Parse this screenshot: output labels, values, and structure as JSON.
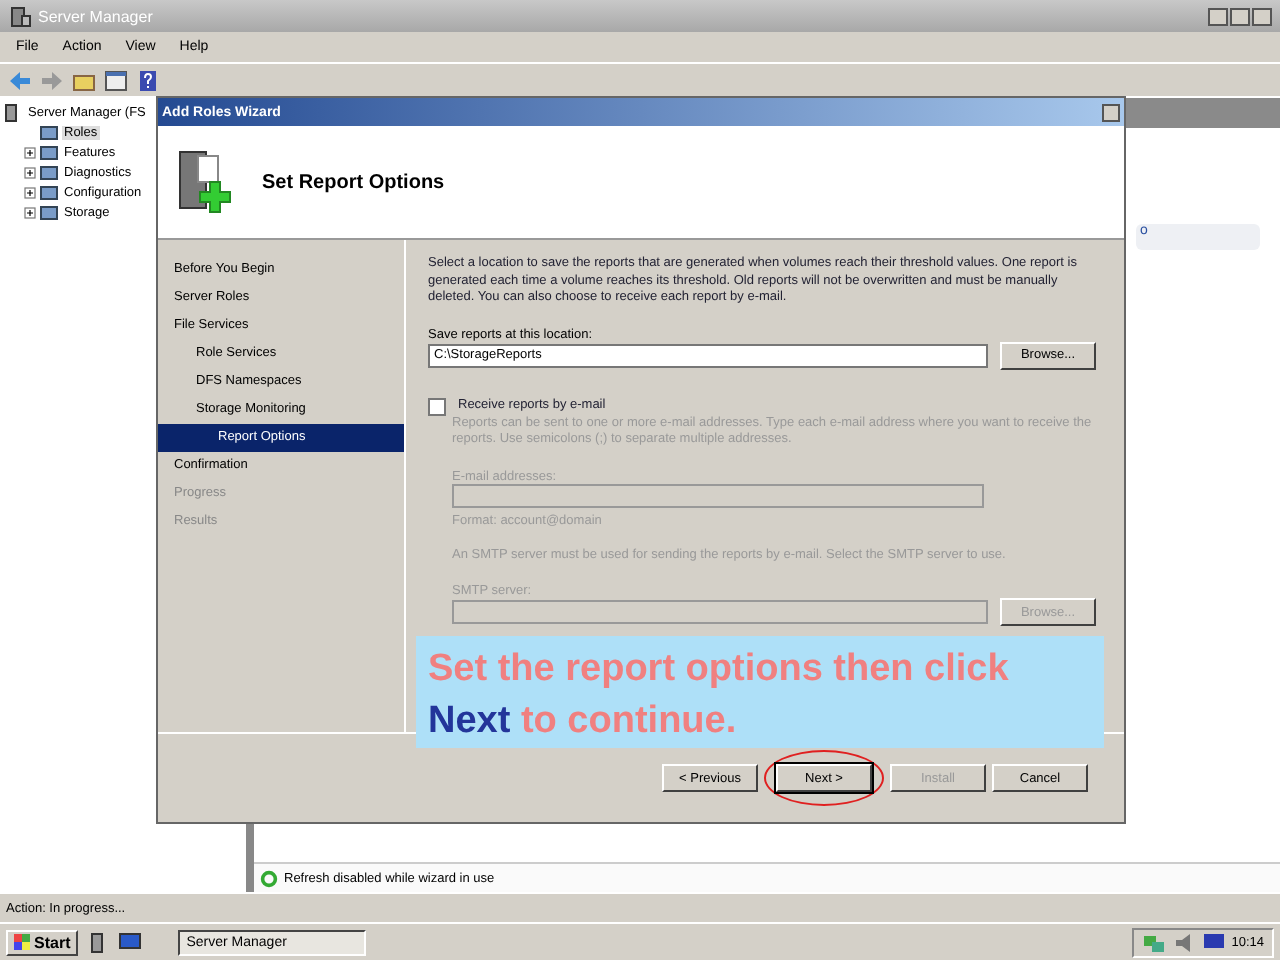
{
  "window": {
    "title": "Server Manager"
  },
  "menu": [
    "File",
    "Action",
    "View",
    "Help"
  ],
  "tree": {
    "label": "Server Manager (FS",
    "children": [
      {
        "label": "Roles",
        "selected": true,
        "expandable": false
      },
      {
        "label": "Features",
        "selected": false,
        "expandable": true
      },
      {
        "label": "Diagnostics",
        "selected": false,
        "expandable": true
      },
      {
        "label": "Configuration",
        "selected": false,
        "expandable": true
      },
      {
        "label": "Storage",
        "selected": false,
        "expandable": true
      }
    ]
  },
  "right_pane": {
    "partial_link": "o",
    "refresh_notice": "Refresh disabled while wizard in use"
  },
  "status_bar": "Action: In progress...",
  "wizard": {
    "title": "Add Roles Wizard",
    "heading": "Set Report Options",
    "steps": [
      {
        "label": "Before You Begin",
        "selected": false,
        "disabled": false
      },
      {
        "label": "Server Roles",
        "selected": false,
        "disabled": false
      },
      {
        "label": "File Services",
        "selected": false,
        "disabled": false,
        "children": [
          {
            "label": "Role Services",
            "selected": false,
            "disabled": false
          },
          {
            "label": "DFS Namespaces",
            "selected": false,
            "disabled": false
          },
          {
            "label": "Storage Monitoring",
            "selected": false,
            "disabled": false,
            "children": [
              {
                "label": "Report Options",
                "selected": true,
                "disabled": false
              }
            ]
          }
        ]
      },
      {
        "label": "Confirmation",
        "selected": false,
        "disabled": false
      },
      {
        "label": "Progress",
        "selected": false,
        "disabled": true
      },
      {
        "label": "Results",
        "selected": false,
        "disabled": true
      }
    ],
    "description": "Select a location to save the reports that are generated when volumes reach their threshold values. One report is generated each time a volume reaches its threshold. Old reports will not be overwritten and must be manually deleted. You can also choose to receive each report by e-mail.",
    "location": {
      "label": "Save reports at this location:",
      "value": "C:\\StorageReports",
      "button": "Browse..."
    },
    "email": {
      "label": "Receive reports by e-mail",
      "checked": false,
      "note": "Reports can be sent to one or more e-mail addresses. Type each e-mail address where you want to receive the reports. Use semicolons (;) to separate multiple addresses.",
      "addresses_label": "E-mail addresses:",
      "addresses_disabled": true,
      "format": "Format: account@domain",
      "smtp_note": "An SMTP server must be used for sending the reports by e-mail. Select the SMTP server to use.",
      "smtp_label": "SMTP server:",
      "smtp_disabled": true,
      "smtp_button": "Browse..."
    },
    "buttons": [
      {
        "label": "< Previous",
        "disabled": false,
        "highlighted": false
      },
      {
        "label": "Next >",
        "disabled": false,
        "highlighted": true
      },
      {
        "label": "Install",
        "disabled": true,
        "highlighted": false
      },
      {
        "label": "Cancel",
        "disabled": false,
        "highlighted": false
      }
    ]
  },
  "callout": {
    "before": "Set the report options then click",
    "emphasis": "Next",
    "after": "to continue."
  },
  "taskbar": {
    "start": "Start",
    "task": "Server Manager",
    "time": "10:14"
  }
}
